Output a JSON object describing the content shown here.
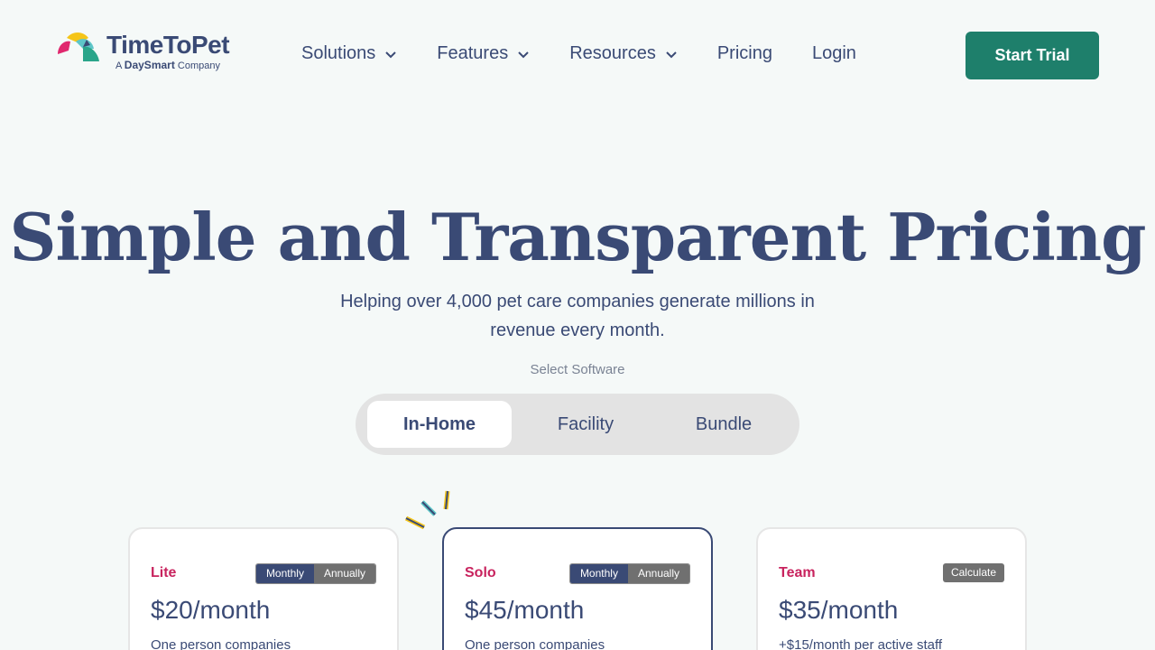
{
  "header": {
    "logo": {
      "word": "TimeToPet",
      "sub_prefix": "A",
      "sub_brand": "DaySmart",
      "sub_suffix": "Company"
    },
    "nav": [
      {
        "label": "Solutions",
        "has_dropdown": true
      },
      {
        "label": "Features",
        "has_dropdown": true
      },
      {
        "label": "Resources",
        "has_dropdown": true
      },
      {
        "label": "Pricing",
        "has_dropdown": false
      },
      {
        "label": "Login",
        "has_dropdown": false
      }
    ],
    "cta": "Start Trial"
  },
  "hero": {
    "title": "Simple and Transparent Pricing",
    "subtitle": "Helping over 4,000 pet care companies generate millions in revenue every month.",
    "select_label": "Select Software",
    "segments": [
      "In-Home",
      "Facility",
      "Bundle"
    ],
    "selected_segment": "In-Home"
  },
  "plans": [
    {
      "name": "Lite",
      "toggle": [
        "Monthly",
        "Annually"
      ],
      "active_toggle": "Monthly",
      "price": "$20/month",
      "desc": "One person companies"
    },
    {
      "name": "Solo",
      "toggle": [
        "Monthly",
        "Annually"
      ],
      "active_toggle": "Monthly",
      "price": "$45/month",
      "desc": "One person companies"
    },
    {
      "name": "Team",
      "calc_label": "Calculate",
      "price": "$35/month",
      "desc": "+$15/month per active staff"
    }
  ],
  "colors": {
    "brand_navy": "#3a4a75",
    "brand_green": "#1e7f6b",
    "plan_pink": "#c8235e",
    "background": "#f5f9f8"
  }
}
